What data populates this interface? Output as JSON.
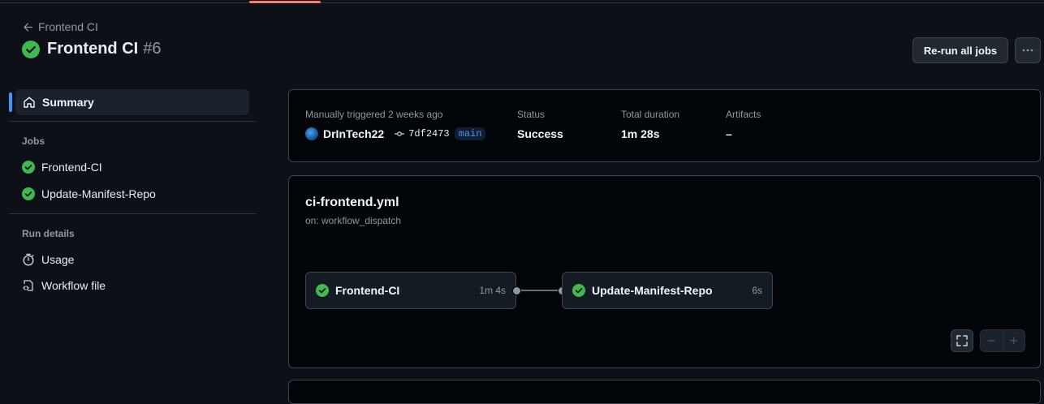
{
  "header": {
    "back_label": "Frontend CI",
    "title": "Frontend CI",
    "run_number": "#6",
    "rerun_label": "Re-run all jobs"
  },
  "sidebar": {
    "summary_label": "Summary",
    "jobs_heading": "Jobs",
    "jobs": [
      {
        "label": "Frontend-CI"
      },
      {
        "label": "Update-Manifest-Repo"
      }
    ],
    "run_details_heading": "Run details",
    "details": [
      {
        "label": "Usage",
        "icon": "stopwatch-icon"
      },
      {
        "label": "Workflow file",
        "icon": "file-code-icon"
      }
    ]
  },
  "info": {
    "trigger_label": "Manually triggered 2 weeks ago",
    "actor": "DrInTech22",
    "commit": "7df2473",
    "branch": "main",
    "status_label": "Status",
    "status_value": "Success",
    "duration_label": "Total duration",
    "duration_value": "1m 28s",
    "artifacts_label": "Artifacts",
    "artifacts_value": "–"
  },
  "workflow": {
    "file": "ci-frontend.yml",
    "trigger": "on: workflow_dispatch",
    "jobs": [
      {
        "name": "Frontend-CI",
        "duration": "1m 4s"
      },
      {
        "name": "Update-Manifest-Repo",
        "duration": "6s"
      }
    ]
  },
  "colors": {
    "success": "#3fb950",
    "accent": "#4493f8",
    "tab_underline": "#f78166"
  }
}
